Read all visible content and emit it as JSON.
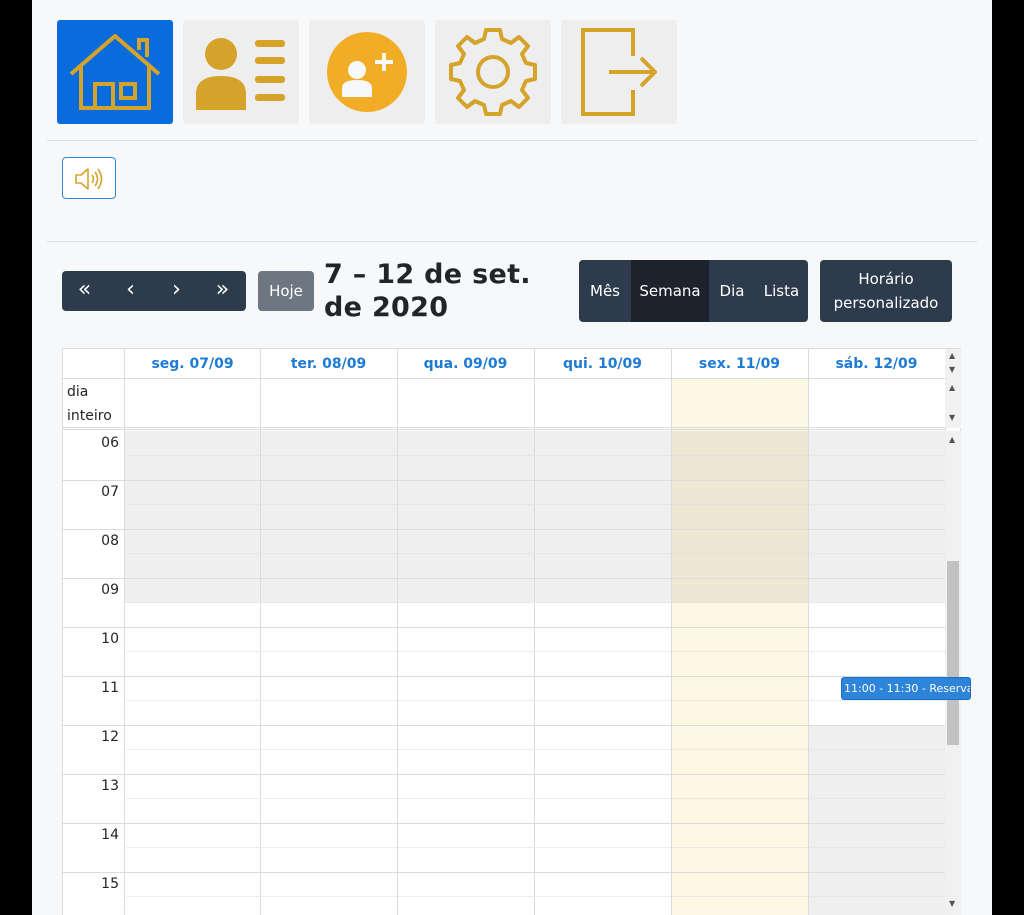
{
  "nav": {
    "items": [
      {
        "name": "home",
        "icon": "house-icon",
        "active": true
      },
      {
        "name": "profile",
        "icon": "user-list-icon",
        "active": false
      },
      {
        "name": "add-user",
        "icon": "user-plus-icon",
        "active": false
      },
      {
        "name": "settings",
        "icon": "gear-icon",
        "active": false
      },
      {
        "name": "logout",
        "icon": "exit-icon",
        "active": false
      }
    ]
  },
  "sound": {
    "icon": "speaker-icon"
  },
  "toolbar": {
    "prev_year": "«",
    "prev": "‹",
    "next": "›",
    "next_year": "»",
    "today_label": "Hoje",
    "title": "7 – 12 de set. de 2020",
    "views": {
      "month": "Mês",
      "week": "Semana",
      "day": "Dia",
      "list": "Lista",
      "active": "Semana"
    },
    "custom_hours_label": "Horário personalizado"
  },
  "calendar": {
    "days": [
      "seg. 07/09",
      "ter. 08/09",
      "qua. 09/09",
      "qui. 10/09",
      "sex. 11/09",
      "sáb. 12/09"
    ],
    "today_index": 4,
    "all_day_label": "dia inteiro",
    "hours": [
      "06",
      "07",
      "08",
      "09",
      "10",
      "11",
      "12",
      "13",
      "14",
      "15"
    ],
    "event": {
      "text": "11:00 - 11:30 - Reserva",
      "day": "sáb. 12/09"
    }
  },
  "colors": {
    "accent": "#0a6cdc",
    "icon_gold": "#d6a32a",
    "dark_button": "#2d3b4c",
    "today_bg": "#fbf8e3",
    "event": "#2e84d8"
  }
}
